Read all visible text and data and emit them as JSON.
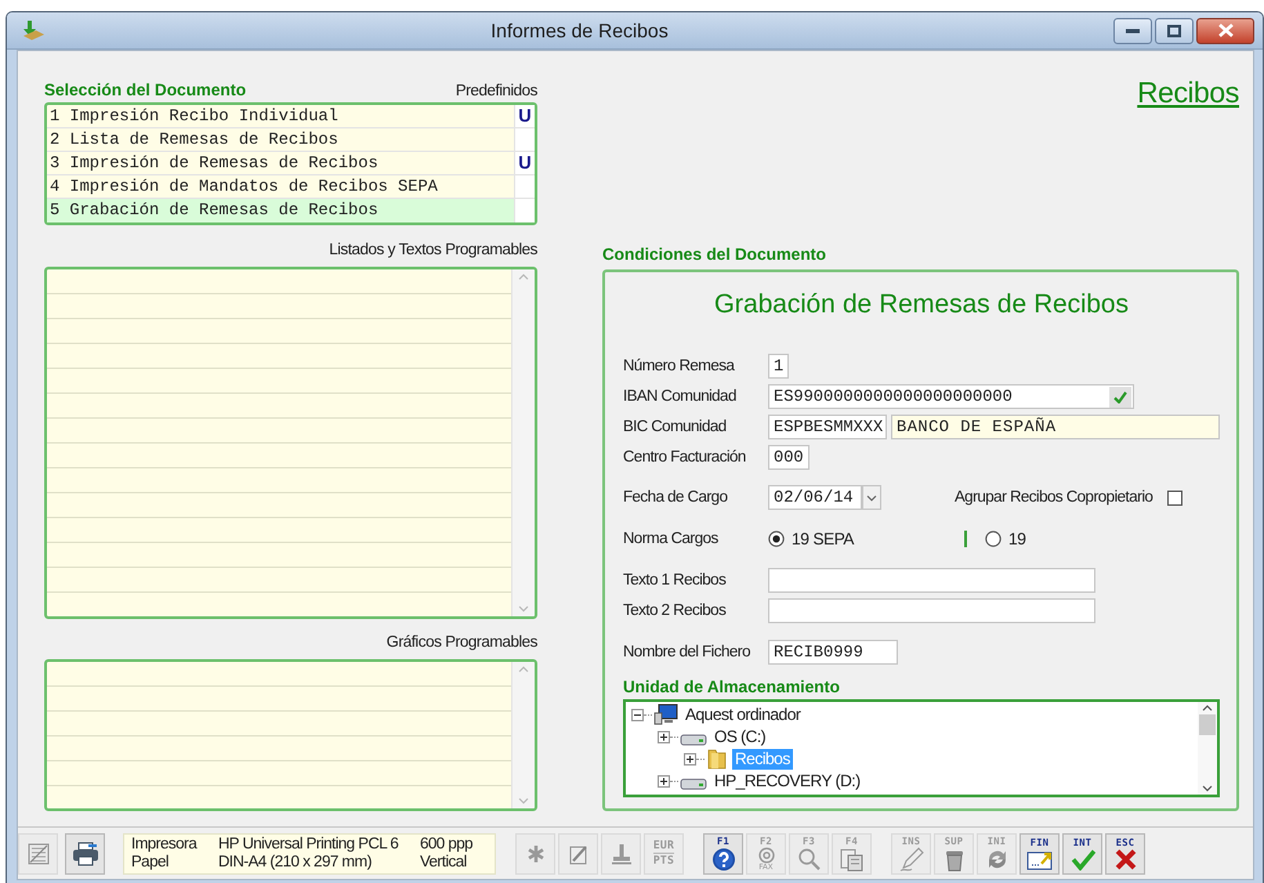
{
  "window": {
    "title": "Informes de Recibos"
  },
  "heading": "Recibos",
  "document_selection": {
    "title": "Selección del Documento",
    "column_label": "Predefinidos",
    "items": [
      {
        "label": "1 Impresión Recibo Individual",
        "mark": "U",
        "selected": false
      },
      {
        "label": "2 Lista de Remesas de Recibos",
        "selected": false
      },
      {
        "label": "3 Impresión de Remesas de Recibos",
        "mark": "U",
        "selected": false
      },
      {
        "label": "4 Impresión de Mandatos de Recibos SEPA",
        "selected": false
      },
      {
        "label": "5 Grabación de Remesas de Recibos",
        "selected": true
      }
    ]
  },
  "programmable_lists": {
    "title": "Listados y Textos Programables"
  },
  "programmable_graphics": {
    "title": "Gráficos Programables"
  },
  "conditions": {
    "title": "Condiciones del Documento",
    "heading": "Grabación de Remesas de Recibos",
    "batch_number": {
      "label": "Número Remesa",
      "value": "1"
    },
    "iban": {
      "label": "IBAN Comunidad",
      "value": "ES9900000000000000000000",
      "valid": true
    },
    "bic": {
      "label": "BIC Comunidad",
      "value": "ESPBESMMXXX",
      "bank_name": "BANCO DE ESPAÑA"
    },
    "billing_center": {
      "label": "Centro Facturación",
      "value": "000"
    },
    "charge_date": {
      "label": "Fecha de Cargo",
      "value": "02/06/14"
    },
    "group_receipts": {
      "label": "Agrupar Recibos Copropietario",
      "checked": false
    },
    "charge_standard": {
      "label": "Norma Cargos",
      "options": [
        {
          "label": "19 SEPA",
          "selected": true
        },
        {
          "label": "19",
          "selected": false
        }
      ]
    },
    "text_1": {
      "label": "Texto 1 Recibos"
    },
    "text_2": {
      "label": "Texto 2 Recibos"
    },
    "file_name": {
      "label": "Nombre del Fichero",
      "value": "RECIB0999"
    },
    "storage": {
      "title": "Unidad de Almacenamiento",
      "tree": [
        {
          "label": "Aquest ordinador",
          "kind": "computer",
          "expanded": true,
          "selected": false,
          "children": [
            {
              "label": "OS (C:)",
              "kind": "drive",
              "expanded": false,
              "selected": false,
              "children": [
                {
                  "label": "Recibos",
                  "kind": "folder",
                  "expanded": false,
                  "selected": false,
                  "highlighted": true
                }
              ]
            },
            {
              "label": "HP_RECOVERY (D:)",
              "kind": "drive",
              "expanded": false,
              "selected": false
            }
          ]
        }
      ]
    }
  },
  "footer": {
    "buttons": [
      {
        "kind": "report",
        "disabled": true
      },
      {
        "kind": "printer",
        "disabled": false
      }
    ],
    "printer_info": [
      {
        "label": "Impresora",
        "value": "HP Universal Printing PCL 6",
        "extra": "600 ppp"
      },
      {
        "label": "Papel",
        "value": "DIN-A4 (210 x 297 mm)",
        "extra": "Vertical"
      }
    ],
    "toolbar_groups": [
      {
        "buttons": [
          {
            "kind": "asterisk",
            "disabled": true
          },
          {
            "kind": "edit",
            "disabled": true
          },
          {
            "kind": "stamp",
            "disabled": true
          },
          {
            "kind": "currency",
            "key": "EUR",
            "sub": "PTS",
            "disabled": true
          }
        ]
      },
      {
        "buttons": [
          {
            "kind": "help",
            "key": "F1",
            "disabled": false
          },
          {
            "kind": "fax",
            "key": "F2",
            "sub": "FAX",
            "disabled": true
          },
          {
            "kind": "search",
            "key": "F3",
            "disabled": true
          },
          {
            "kind": "documents",
            "key": "F4",
            "disabled": true
          }
        ]
      },
      {
        "buttons": [
          {
            "kind": "pen",
            "key": "INS",
            "disabled": true
          },
          {
            "kind": "trash",
            "key": "SUP",
            "disabled": true
          },
          {
            "kind": "refresh",
            "key": "INI",
            "disabled": true
          },
          {
            "kind": "finish",
            "key": "FIN",
            "disabled": false
          },
          {
            "kind": "accept",
            "key": "INT",
            "disabled": false
          },
          {
            "kind": "cancel",
            "key": "ESC",
            "disabled": false
          }
        ]
      }
    ]
  }
}
